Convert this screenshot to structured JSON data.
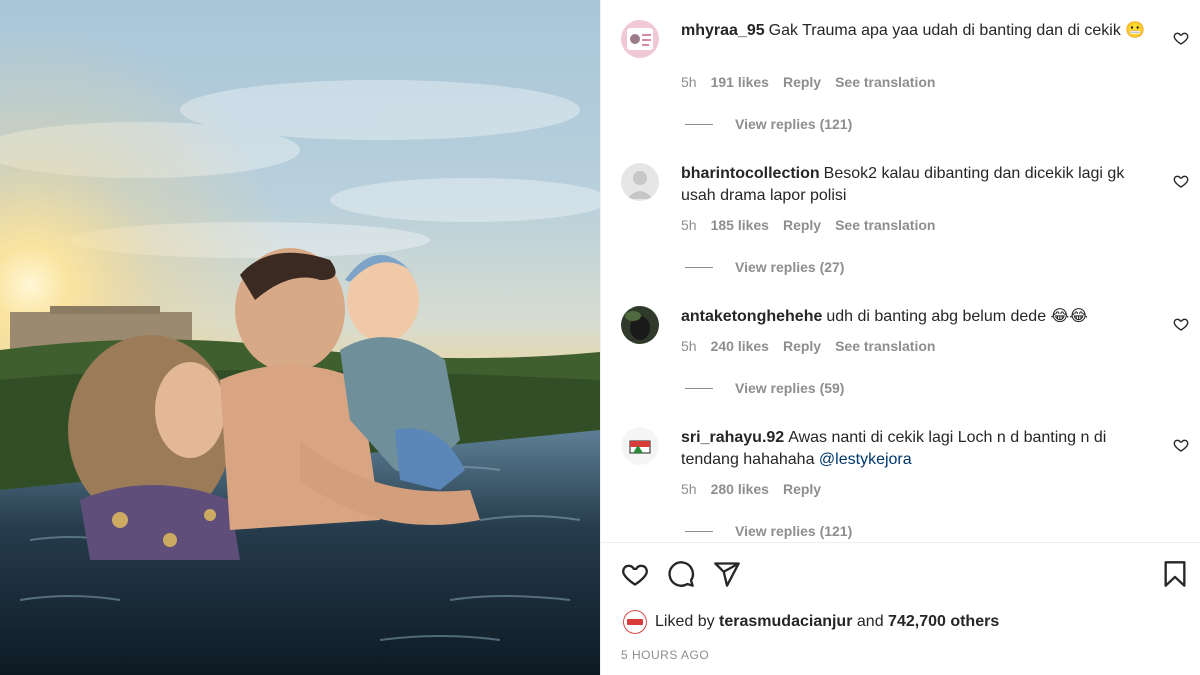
{
  "post": {
    "image_alt": "Family in infinity pool at sunset"
  },
  "comments": [
    {
      "username": "mhyraa_95",
      "text": "Gak Trauma apa yaa udah di banting dan di cekik 😬",
      "time": "5h",
      "likes": "191 likes",
      "reply": "Reply",
      "translate": "See translation",
      "view_replies": "View replies (121)"
    },
    {
      "username": "bharintocollection",
      "text": "Besok2 kalau dibanting dan dicekik lagi gk usah drama lapor polisi",
      "time": "5h",
      "likes": "185 likes",
      "reply": "Reply",
      "translate": "See translation",
      "view_replies": "View replies (27)"
    },
    {
      "username": "antaketonghehehe",
      "text": "udh di banting abg belum dede 😂😂",
      "time": "5h",
      "likes": "240 likes",
      "reply": "Reply",
      "translate": "See translation",
      "view_replies": "View replies (59)"
    },
    {
      "username": "sri_rahayu.92",
      "text": "Awas nanti di cekik lagi Loch n d banting n di tendang hahahaha",
      "mention": "@lestykejora",
      "time": "5h",
      "likes": "280 likes",
      "reply": "Reply",
      "view_replies": "View replies (121)"
    }
  ],
  "actions": {
    "icons": [
      "heart-icon",
      "comment-icon",
      "share-icon",
      "bookmark-icon"
    ]
  },
  "likes_line": {
    "prefix": "Liked by",
    "user": "terasmudacianjur",
    "and": "and",
    "others": "742,700 others"
  },
  "timestamp": "5 HOURS AGO",
  "colors": {
    "text": "#262626",
    "muted": "#8e8e8e",
    "mention": "#00376b"
  }
}
